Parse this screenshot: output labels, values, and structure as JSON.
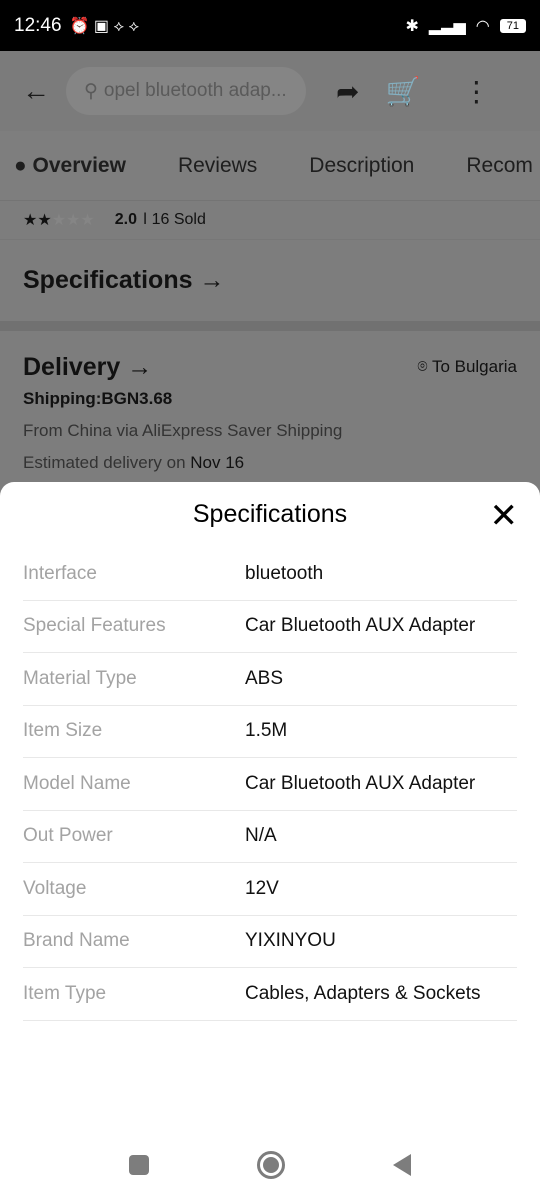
{
  "status": {
    "time": "12:46",
    "battery": "71"
  },
  "header": {
    "search_text": "opel bluetooth adap..."
  },
  "tabs": [
    "Overview",
    "Reviews",
    "Description",
    "Recom"
  ],
  "rating": {
    "score": "2.0",
    "sold": "16 Sold",
    "stars_filled": 2,
    "stars_total": 5
  },
  "specs_link": "Specifications →",
  "delivery": {
    "title": "Delivery →",
    "destination": "To Bulgaria",
    "shipping": "Shipping:BGN3.68",
    "route": "From China via AliExpress Saver Shipping",
    "estimate_prefix": "Estimated delivery on ",
    "estimate_date": "Nov 16"
  },
  "sheet": {
    "title": "Specifications",
    "rows": [
      {
        "k": "Interface",
        "v": "bluetooth"
      },
      {
        "k": "Special Features",
        "v": "Car Bluetooth AUX Adapter"
      },
      {
        "k": "Material Type",
        "v": "ABS"
      },
      {
        "k": "Item Size",
        "v": "1.5M"
      },
      {
        "k": "Model Name",
        "v": "Car Bluetooth AUX Adapter"
      },
      {
        "k": "Out Power",
        "v": "N/A"
      },
      {
        "k": "Voltage",
        "v": "12V"
      },
      {
        "k": "Brand Name",
        "v": "YIXINYOU"
      },
      {
        "k": "Item Type",
        "v": "Cables, Adapters & Sockets"
      }
    ]
  }
}
